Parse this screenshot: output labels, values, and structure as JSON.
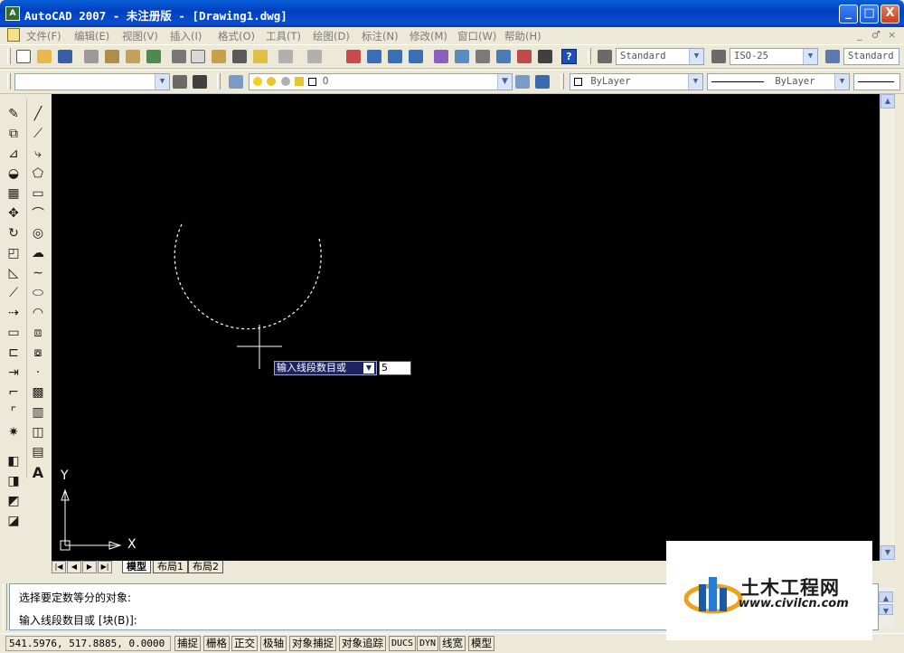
{
  "window": {
    "title": "AutoCAD 2007 - 未注册版 - [Drawing1.dwg]"
  },
  "window_controls": {
    "minimize": "_",
    "maximize": "□",
    "close": "X"
  },
  "menu": {
    "items": [
      "文件(F)",
      "编辑(E)",
      "视图(V)",
      "插入(I)",
      "格式(O)",
      "工具(T)",
      "绘图(D)",
      "标注(N)",
      "修改(M)",
      "窗口(W)",
      "帮助(H)"
    ],
    "mdi_controls": [
      "_",
      "♂",
      "×"
    ]
  },
  "toolbar1": {
    "help_label": "?",
    "text_style": "Standard",
    "dim_style": "ISO-25",
    "table_style": "Standard"
  },
  "toolbar2": {
    "layer": "0",
    "color": "ByLayer",
    "linetype": "ByLayer"
  },
  "drawing": {
    "tooltip_prompt": "输入线段数目或",
    "tooltip_value": "5",
    "ucs_x": "X",
    "ucs_y": "Y"
  },
  "tabs": {
    "model": "模型",
    "layout1": "布局1",
    "layout2": "布局2"
  },
  "command": {
    "line1": "选择要定数等分的对象:",
    "line2": "输入线段数目或 [块(B)]:"
  },
  "status": {
    "coords": "541.5976, 517.8885, 0.0000",
    "buttons": [
      "捕捉",
      "栅格",
      "正交",
      "极轴",
      "对象捕捉",
      "对象追踪",
      "DUCS",
      "DYN",
      "线宽",
      "模型"
    ]
  },
  "watermark": {
    "name": "土木工程网",
    "url": "www.civilcn.com"
  },
  "colors": {
    "titlebar": "#0a4fd0",
    "canvas": "#000000",
    "tooltip_bg": "#1c2360"
  }
}
